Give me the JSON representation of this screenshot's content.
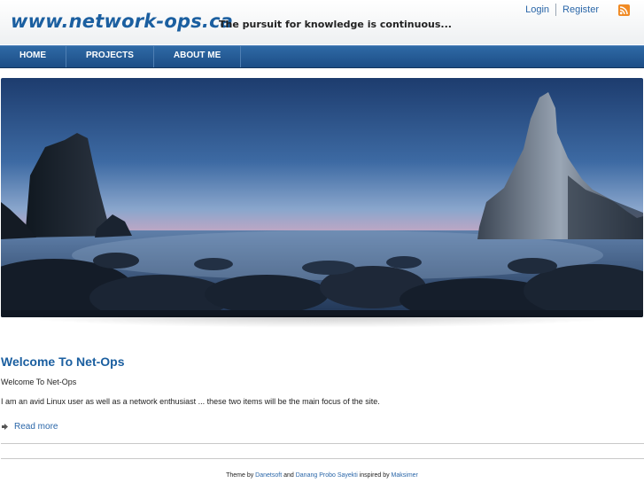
{
  "header": {
    "site_title": "www.network-ops.ca",
    "tagline": "The pursuit for knowledge is continuous...",
    "login": "Login",
    "register": "Register",
    "rss_icon": "rss-feed-icon",
    "rss_color": "#f08a24"
  },
  "nav": {
    "items": [
      {
        "label": "HOME"
      },
      {
        "label": "PROJECTS"
      },
      {
        "label": "ABOUT ME"
      }
    ]
  },
  "hero": {
    "image": "seascape-rocks-dusk"
  },
  "content": {
    "title": "Welcome To Net-Ops",
    "subtitle": "Welcome To Net-Ops",
    "intro": "I am an avid Linux user as well as a network enthusiast ... these two items will be the main focus of the site.",
    "read_more": "Read more"
  },
  "footer": {
    "prefix": "Theme by",
    "author1": "Danetsoft",
    "and": "and",
    "author2": "Danang Probo Sayekti",
    "inspired": "inspired by",
    "author3": "Maksimer"
  },
  "colors": {
    "accent": "#1b5fa0",
    "nav_bg": "#2a5f99",
    "link": "#2a66a8"
  }
}
